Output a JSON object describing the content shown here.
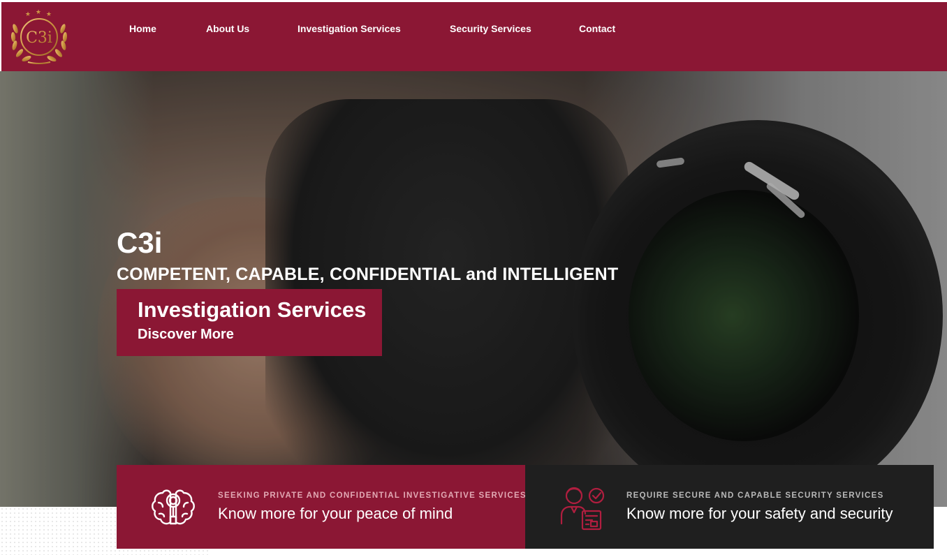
{
  "logo": {
    "text": "C3i",
    "icon": "laurel-crest-logo"
  },
  "nav": {
    "items": [
      {
        "label": "Home"
      },
      {
        "label": "About Us"
      },
      {
        "label": "Investigation Services"
      },
      {
        "label": "Security Services"
      },
      {
        "label": "Contact"
      }
    ]
  },
  "hero": {
    "brand": "C3i",
    "tagline": "COMPETENT, CAPABLE, CONFIDENTIAL and INTELLIGENT",
    "cta": {
      "title": "Investigation Services",
      "subtitle": "Discover More"
    }
  },
  "cards": [
    {
      "icon": "brain-magnifier-icon",
      "kicker": "SEEKING PRIVATE AND CONFIDENTIAL INVESTIGATIVE SERVICES",
      "headline": "Know more for your peace of mind"
    },
    {
      "icon": "security-agent-checklist-icon",
      "kicker": "REQUIRE SECURE AND CAPABLE SECURITY SERVICES",
      "headline": "Know more for your safety and security"
    }
  ],
  "colors": {
    "brand": "#8b1734",
    "dark_card": "#1f1f1f",
    "gold": "#c9923e"
  }
}
